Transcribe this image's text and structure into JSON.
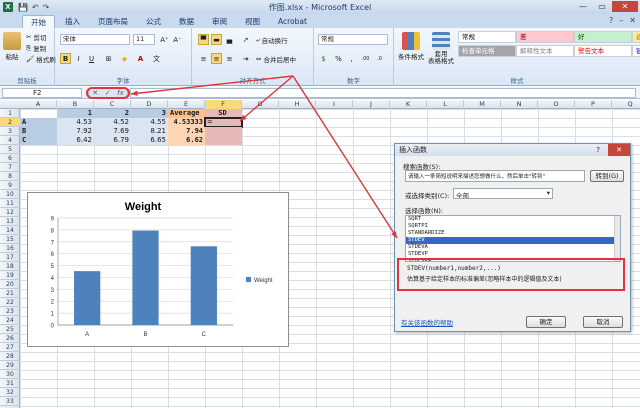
{
  "window": {
    "title": "作图.xlsx - Microsoft Excel",
    "app_letter": "X",
    "qat": [
      "💾",
      "↶",
      "↷"
    ],
    "minimize": "—",
    "restore": "▭",
    "close": "✕"
  },
  "tabs": [
    "开始",
    "插入",
    "页面布局",
    "公式",
    "数据",
    "审阅",
    "视图",
    "Acrobat"
  ],
  "active_tab": "开始",
  "ribbon": {
    "clipboard": {
      "label": "剪贴板",
      "paste": "粘贴",
      "cut": "剪切",
      "copy": "复制",
      "format_painter": "格式刷"
    },
    "font": {
      "label": "字体",
      "name": "宋体",
      "size": "11",
      "grow": "A⁺",
      "shrink": "A⁻",
      "bold": "B",
      "italic": "I",
      "underline": "U",
      "wen": "文"
    },
    "alignment": {
      "label": "对齐方式",
      "wrap": "自动换行",
      "merge": "合并后居中"
    },
    "number": {
      "label": "数字",
      "format": "常规",
      "percent": "%",
      "comma": ",",
      "inc": ".00",
      "dec": ".0"
    },
    "styles": {
      "label": "样式",
      "conditional": "条件格式",
      "table": "套用\n表格格式",
      "cells": [
        {
          "text": "常规",
          "color": "#ffffff",
          "fg": "#000000"
        },
        {
          "text": "差",
          "color": "#ffc7ce",
          "fg": "#9c0006"
        },
        {
          "text": "好",
          "color": "#c6efce",
          "fg": "#006100"
        },
        {
          "text": "适",
          "color": "#ffeb9c",
          "fg": "#9c6500"
        },
        {
          "text": "检查单元格",
          "color": "#a5a5a5",
          "fg": "#ffffff"
        },
        {
          "text": "解释性文本",
          "color": "#ffffff",
          "fg": "#7f7f7f"
        },
        {
          "text": "警告文本",
          "color": "#ffffff",
          "fg": "#ff0000"
        },
        {
          "text": "链",
          "color": "#ffffff",
          "fg": "#0000ff"
        }
      ]
    }
  },
  "formula_bar": {
    "name_box": "F2",
    "fx": "fx",
    "cancel": "✕",
    "enter": "✓",
    "content": ""
  },
  "columns": [
    "A",
    "B",
    "C",
    "D",
    "E",
    "F",
    "G",
    "H",
    "I",
    "J",
    "K",
    "L",
    "M",
    "N",
    "O",
    "P",
    "Q"
  ],
  "rows": [
    "1",
    "2",
    "3",
    "4",
    "5",
    "6",
    "7",
    "8",
    "9",
    "10",
    "11",
    "12",
    "13",
    "14",
    "15",
    "16",
    "17",
    "18",
    "19",
    "20",
    "21",
    "22",
    "23",
    "24",
    "25",
    "26",
    "27",
    "28",
    "29",
    "30",
    "31",
    "32",
    "33"
  ],
  "sheet": {
    "header": [
      "",
      "1",
      "2",
      "3",
      "Average",
      "SD"
    ],
    "data": [
      {
        "label": "A",
        "v": [
          "4.53",
          "4.52",
          "4.55"
        ],
        "avg": "4.53333",
        "sd": "="
      },
      {
        "label": "B",
        "v": [
          "7.92",
          "7.69",
          "8.21"
        ],
        "avg": "7.94",
        "sd": ""
      },
      {
        "label": "C",
        "v": [
          "6.42",
          "6.79",
          "6.65"
        ],
        "avg": "6.62",
        "sd": ""
      }
    ]
  },
  "chart_data": {
    "type": "bar",
    "title": "Weight",
    "categories": [
      "A",
      "B",
      "C"
    ],
    "series": [
      {
        "name": "Weight",
        "values": [
          4.53,
          7.94,
          6.62
        ],
        "color": "#4f81bd"
      }
    ],
    "ylim": [
      0,
      9
    ],
    "yticks": [
      "0",
      "1",
      "2",
      "3",
      "4",
      "5",
      "6",
      "7",
      "8",
      "9"
    ],
    "legend": "right",
    "grid": true
  },
  "dialog": {
    "title": "插入函数",
    "help": "?",
    "close": "✕",
    "search_label": "搜索函数(S):",
    "search_text": "请输入一条简短说明来描述您想做什么，然后单击\"转到\"",
    "go": "转到(G)",
    "category_label": "或选择类别(C):",
    "category_value": "全部",
    "select_label": "选择函数(N):",
    "functions": [
      "SQRT",
      "SQRTPI",
      "STANDARDIZE",
      "STDEV",
      "STDEVA",
      "STDEVP",
      "STDEVPA"
    ],
    "selected": "STDEV",
    "signature": "STDEV(number1,number2,...)",
    "description": "估算基于给定样本的标准偏差(忽略样本中的逻辑值及文本)",
    "help_link": "有关该函数的帮助",
    "ok": "确定",
    "cancel": "取消"
  },
  "colors": {
    "arrow": "#e0343a",
    "bar": "#4f81bd"
  }
}
